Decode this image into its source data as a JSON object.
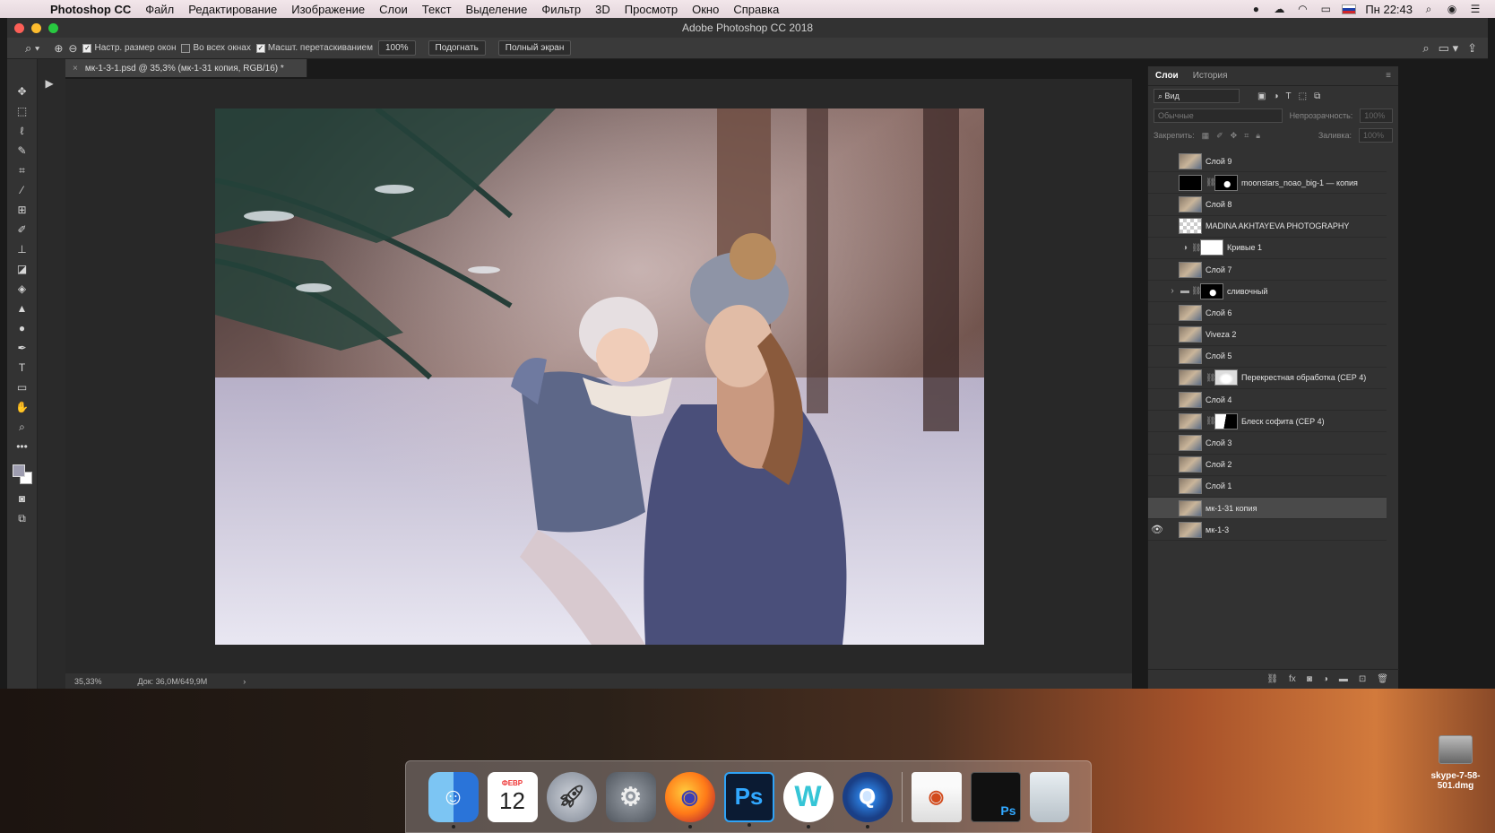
{
  "menubar": {
    "apple": "",
    "app_name": "Photoshop CC",
    "menus": [
      "Файл",
      "Редактирование",
      "Изображение",
      "Слои",
      "Текст",
      "Выделение",
      "Фильтр",
      "3D",
      "Просмотр",
      "Окно",
      "Справка"
    ],
    "clock": "Пн 22:43"
  },
  "window": {
    "title": "Adobe Photoshop CC 2018"
  },
  "options_bar": {
    "resize_windows": "Настр. размер окон",
    "all_windows": "Во всех окнах",
    "scrubby_zoom": "Масшт. перетаскиванием",
    "zoom_value": "100%",
    "fit_button": "Подогнать",
    "fullscreen_button": "Полный экран"
  },
  "document": {
    "tab_title": "мк-1-3-1.psd @ 35,3% (мк-1-31 копия, RGB/16) *",
    "zoom": "35,33%",
    "doc_size": "Док: 36,0M/649,9M"
  },
  "layers_panel": {
    "tab_layers": "Слои",
    "tab_history": "История",
    "filter_label": "Вид",
    "blend_mode": "Обычные",
    "opacity_label": "Непрозрачность:",
    "opacity_value": "100%",
    "lock_label": "Закрепить:",
    "fill_label": "Заливка:",
    "fill_value": "100%",
    "layers": [
      {
        "name": "Слой 9",
        "thumb": "photo-t",
        "mask": ""
      },
      {
        "name": "moonstars_noao_big-1 — копия",
        "thumb": "black",
        "mask": "mask"
      },
      {
        "name": "Слой 8",
        "thumb": "photo-t",
        "mask": ""
      },
      {
        "name": "MADINA  AKHTAYEVA  PHOTOGRAPHY",
        "thumb": "checker",
        "mask": ""
      },
      {
        "name": "Кривые 1",
        "thumb": "adjust",
        "mask": "white"
      },
      {
        "name": "Слой 7",
        "thumb": "photo-t",
        "mask": ""
      },
      {
        "name": "сливочный",
        "thumb": "folder",
        "mask": "mask"
      },
      {
        "name": "Слой 6",
        "thumb": "photo-t",
        "mask": ""
      },
      {
        "name": "Viveza 2",
        "thumb": "photo-t",
        "mask": ""
      },
      {
        "name": "Слой 5",
        "thumb": "photo-t",
        "mask": ""
      },
      {
        "name": "Перекрестная обработка (СЕР 4)",
        "thumb": "photo-t",
        "mask": "mask2"
      },
      {
        "name": "Слой 4",
        "thumb": "photo-t",
        "mask": ""
      },
      {
        "name": "Блеск софита (СЕР 4)",
        "thumb": "photo-t",
        "mask": "mask3"
      },
      {
        "name": "Слой 3",
        "thumb": "photo-t",
        "mask": ""
      },
      {
        "name": "Слой 2",
        "thumb": "photo-t",
        "mask": ""
      },
      {
        "name": "Слой 1",
        "thumb": "photo-t",
        "mask": ""
      },
      {
        "name": "мк-1-31 копия",
        "thumb": "photo-t",
        "mask": "",
        "selected": true
      },
      {
        "name": "мк-1-3",
        "thumb": "photo-t",
        "mask": "",
        "visible": true
      }
    ]
  },
  "dock": {
    "calendar_month": "ФЕВР",
    "calendar_day": "12",
    "photoshop_label": "Ps",
    "w_label": "W"
  },
  "desktop_file": {
    "name": "skype-7-58-501.dmg"
  }
}
